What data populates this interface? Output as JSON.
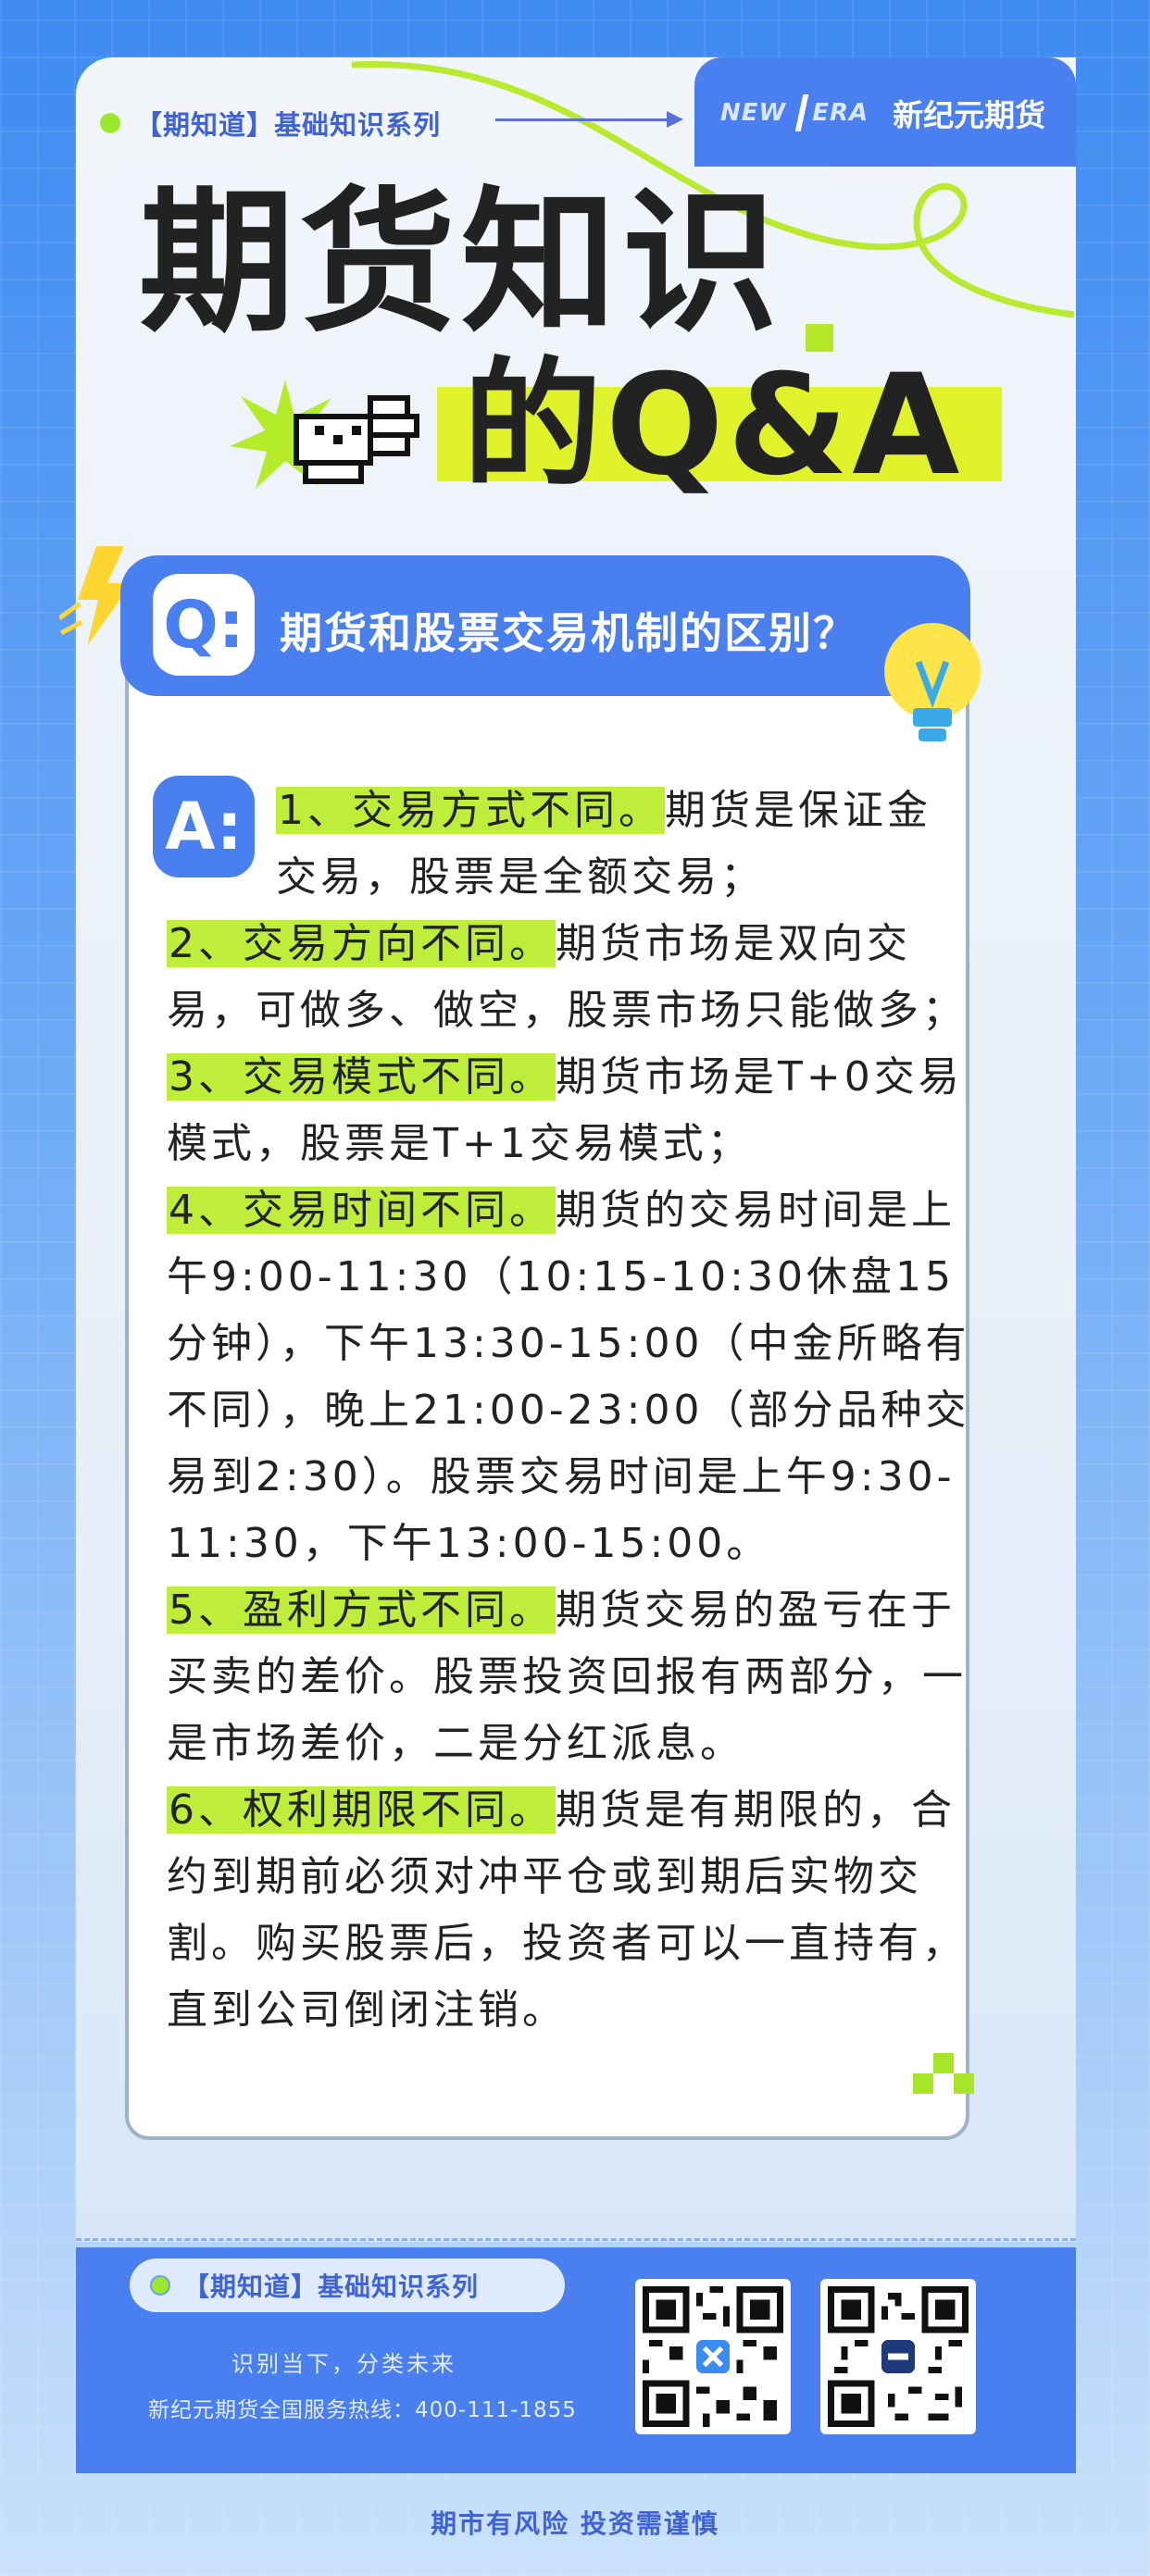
{
  "header": {
    "series": "【期知道】基础知识系列",
    "logo_mark_left": "NEW",
    "logo_mark_right": "ERA",
    "brand": "新纪元期货"
  },
  "title": {
    "line1": "期货知识",
    "line2": "的Q&A"
  },
  "question": {
    "icon": "Q:",
    "text": "期货和股票交易机制的区别？"
  },
  "answer": {
    "icon": "A:",
    "items": [
      {
        "head": "1、交易方式不同。",
        "body1": "期货是保证金",
        "body2": "交易，股票是全额交易；"
      },
      {
        "head": "2、交易方向不同。",
        "body": "期货市场是双向交易，可做多、做空，股票市场只能做多；"
      },
      {
        "head": "3、交易模式不同。",
        "body": "期货市场是T+0交易模式，股票是T+1交易模式；"
      },
      {
        "head": "4、交易时间不同。",
        "body": "期货的交易时间是上午9:00-11:30（10:15-10:30休盘15分钟），下午13:30-15:00（中金所略有不同），晚上21:00-23:00（部分品种交易到2:30）。股票交易时间是上午9:30-11:30，下午13:00-15:00。"
      },
      {
        "head": "5、盈利方式不同。",
        "body": "期货交易的盈亏在于买卖的差价。股票投资回报有两部分，一是市场差价，二是分红派息。"
      },
      {
        "head": "6、权利期限不同。",
        "body": "期货是有期限的，合约到期前必须对冲平仓或到期后实物交割。购买股票后，投资者可以一直持有，直到公司倒闭注销。"
      }
    ]
  },
  "footer": {
    "series": "【期知道】基础知识系列",
    "slogan": "识别当下，分类未来",
    "hotline": "新纪元期货全国服务热线：400-111-1855",
    "risk": "期市有风险 投资需谨慎"
  },
  "colors": {
    "accent_blue": "#4a7fef",
    "highlight_green": "#bfee3a"
  }
}
